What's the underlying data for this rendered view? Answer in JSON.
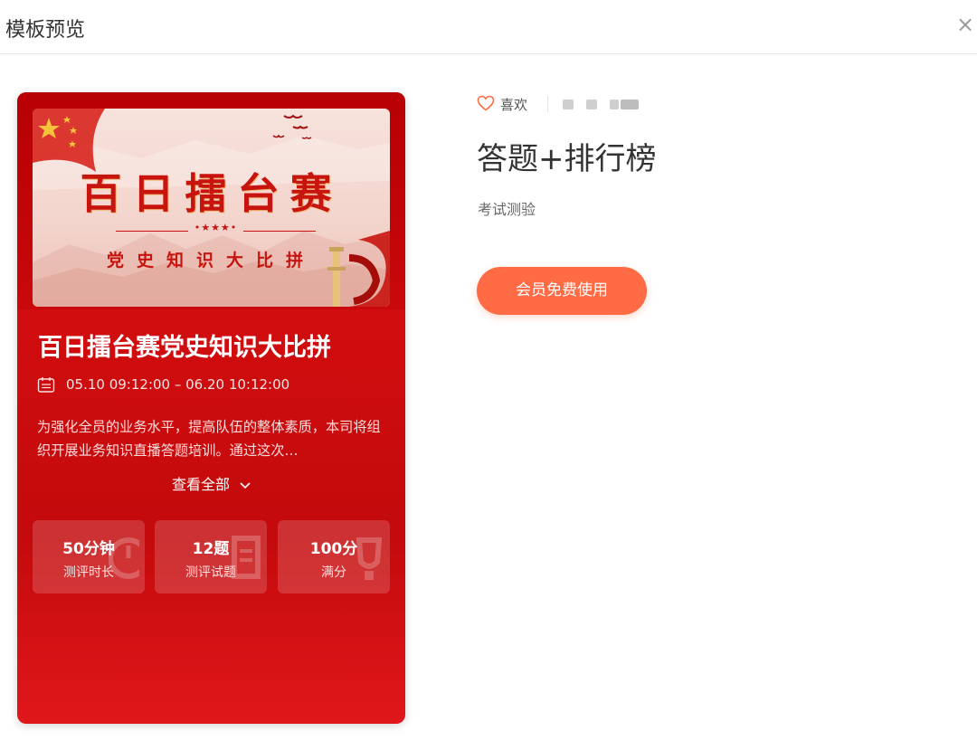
{
  "modal": {
    "title": "模板预览",
    "close_icon": "close-icon"
  },
  "preview": {
    "banner": {
      "headline": "百日擂台赛",
      "subheadline": "党史知识大比拼",
      "divider_stars": "•★★★•"
    },
    "title": "百日擂台赛党史知识大比拼",
    "date_icon": "calendar-icon",
    "date_range": "05.10 09:12:00 – 06.20 10:12:00",
    "description": "为强化全员的业务水平，提高队伍的整体素质，本司将组织开展业务知识直播答题培训。通过这次…",
    "view_all": "查看全部",
    "stats": [
      {
        "value": "50分钟",
        "label": "测评时长"
      },
      {
        "value": "12题",
        "label": "测评试题"
      },
      {
        "value": "100分",
        "label": "满分"
      }
    ]
  },
  "template": {
    "like_label": "喜欢",
    "title": "答题+排行榜",
    "category": "考试测验",
    "action_button": "会员免费使用"
  },
  "colors": {
    "accent": "#ff6b45",
    "card_red": "#c4060a",
    "banner_red": "#c8140e"
  }
}
